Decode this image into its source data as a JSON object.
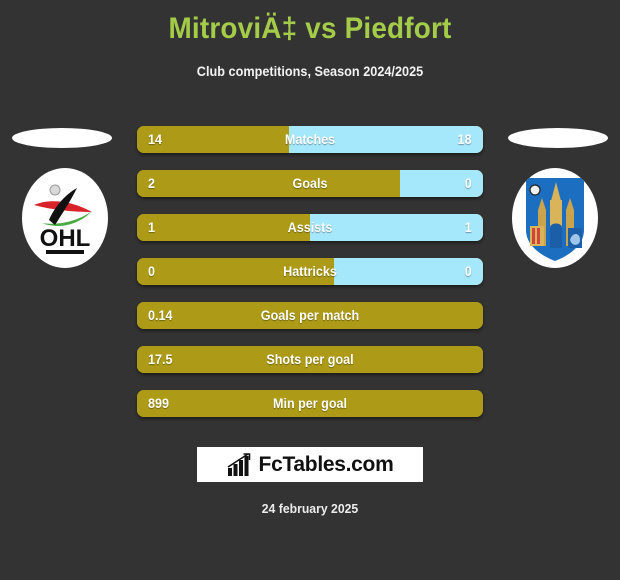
{
  "header": {
    "title": "MitroviÄ‡ vs Piedfort",
    "subtitle": "Club competitions, Season 2024/2025"
  },
  "colors": {
    "background": "#333333",
    "title": "#a5cc48",
    "home_bar": "#ad9a16",
    "away_bar": "#a5e7fb",
    "text": "#ffffff"
  },
  "teams": {
    "home": {
      "badge_icon": "ohl-club-crest",
      "badge_text": "OHL"
    },
    "away": {
      "badge_icon": "leuven-city-crest"
    }
  },
  "stats": [
    {
      "label": "Matches",
      "home": "14",
      "away": "18",
      "home_pct": 43.8,
      "two_sided": true
    },
    {
      "label": "Goals",
      "home": "2",
      "away": "0",
      "home_pct": 76.0,
      "two_sided": true
    },
    {
      "label": "Assists",
      "home": "1",
      "away": "1",
      "home_pct": 50.0,
      "two_sided": true
    },
    {
      "label": "Hattricks",
      "home": "0",
      "away": "0",
      "home_pct": 57.0,
      "two_sided": true
    },
    {
      "label": "Goals per match",
      "home": "0.14",
      "away": "",
      "home_pct": 100,
      "two_sided": false
    },
    {
      "label": "Shots per goal",
      "home": "17.5",
      "away": "",
      "home_pct": 100,
      "two_sided": false
    },
    {
      "label": "Min per goal",
      "home": "899",
      "away": "",
      "home_pct": 100,
      "two_sided": false
    }
  ],
  "brand": {
    "name": "FcTables.com",
    "icon": "bar-chart-icon"
  },
  "footer": {
    "date": "24 february 2025"
  }
}
